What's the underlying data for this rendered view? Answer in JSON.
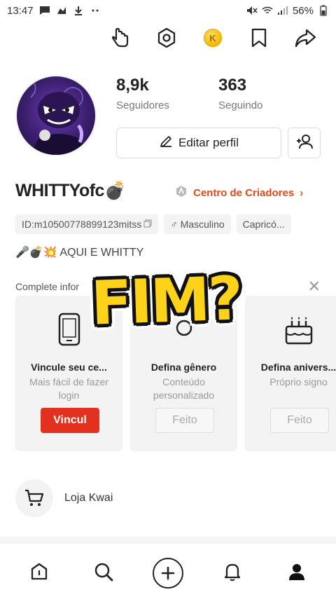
{
  "status_bar": {
    "time": "13:47",
    "battery": "56%"
  },
  "profile": {
    "followers_value": "8,9k",
    "followers_label": "Seguidores",
    "following_value": "363",
    "following_label": "Seguindo",
    "edit_label": "Editar perfil",
    "username": "WHITTYofc💣",
    "creators_label": "Centro de Criadores",
    "tags": [
      "ID:m10500778899123mitss",
      "♂ Masculino",
      "Capricó..."
    ],
    "bio": "🎤💣💥 AQUI E WHITTY"
  },
  "complete": {
    "label": "Complete infor",
    "cards": [
      {
        "title": "Vincule seu ce...",
        "sub": "Mais fácil de fazer login",
        "button": "Vincul",
        "icon": "phone-icon"
      },
      {
        "title": "Defina gênero",
        "sub": "Conteúdo personalizado",
        "button": "Feito",
        "icon": "gender-icon"
      },
      {
        "title": "Defina anivers...",
        "sub": "Próprio signo",
        "button": "Feito",
        "icon": "cake-icon"
      }
    ]
  },
  "overlay_text": "FIM?",
  "shop": {
    "label": "Loja Kwai"
  },
  "colors": {
    "accent": "#e24a1a",
    "primary_button": "#e2321f",
    "overlay": "#ffd21a"
  }
}
